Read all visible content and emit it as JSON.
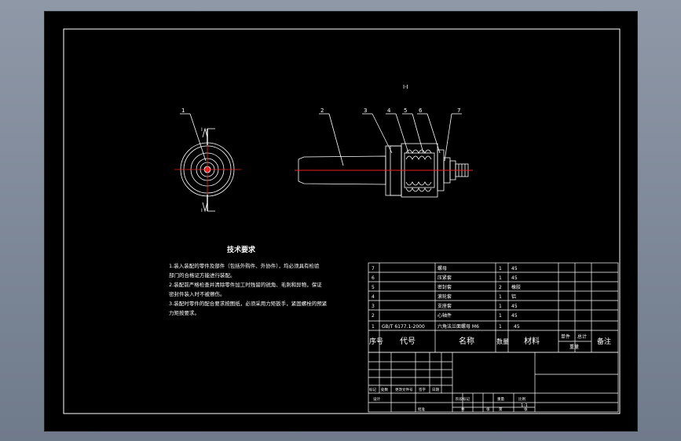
{
  "drawing": {
    "section_label": "I-I",
    "section_mark": "I",
    "balloons": [
      "1",
      "2",
      "3",
      "4",
      "5",
      "6",
      "7"
    ]
  },
  "technical_requirements": {
    "title": "技术要求",
    "lines": [
      "1.装入装配的零件及部件（包括外购件、外协件），均必须具有检验",
      "部门的合格证方能进行装配。",
      "2.装配前严格检查并清除零件加工时残留的锐角、毛刺和异物，保证",
      "密封件装入时不被擦伤。",
      "3.装配时零件的配合要求按图纸，必须采用力矩扳手，紧固螺栓的预紧",
      "力矩按要求。"
    ]
  },
  "bom": {
    "rows": [
      {
        "no": "7",
        "code": "",
        "name": "螺母",
        "qty": "1",
        "material": "45"
      },
      {
        "no": "6",
        "code": "",
        "name": "压紧套",
        "qty": "1",
        "material": "45"
      },
      {
        "no": "5",
        "code": "",
        "name": "密封套",
        "qty": "2",
        "material": "橡胶"
      },
      {
        "no": "4",
        "code": "",
        "name": "滚轮套",
        "qty": "1",
        "material": "铝"
      },
      {
        "no": "3",
        "code": "",
        "name": "支座套",
        "qty": "1",
        "material": "45"
      },
      {
        "no": "2",
        "code": "",
        "name": "心轴件",
        "qty": "1",
        "material": "45"
      },
      {
        "no": "1",
        "code": "GB/T 6177.1-2000",
        "name": "六角法兰面螺母 M6",
        "qty": "1",
        "material": "45"
      }
    ],
    "headers": {
      "no": "序号",
      "code": "代号",
      "name": "名称",
      "qty": "数量",
      "material": "材料",
      "unit_weight": "单件",
      "total_weight": "总计",
      "weight": "重量",
      "remarks": "备注"
    }
  },
  "title_block": {
    "revision_labels": [
      "标记",
      "处数",
      "更改文件号",
      "签字",
      "日期"
    ],
    "designer_label": "设计",
    "stage_labels": [
      "阶段标记",
      "重量",
      "比例"
    ],
    "scale": "1:1",
    "approval_label": "批准",
    "sheet_labels": [
      "共",
      "张",
      "第",
      "张"
    ]
  }
}
